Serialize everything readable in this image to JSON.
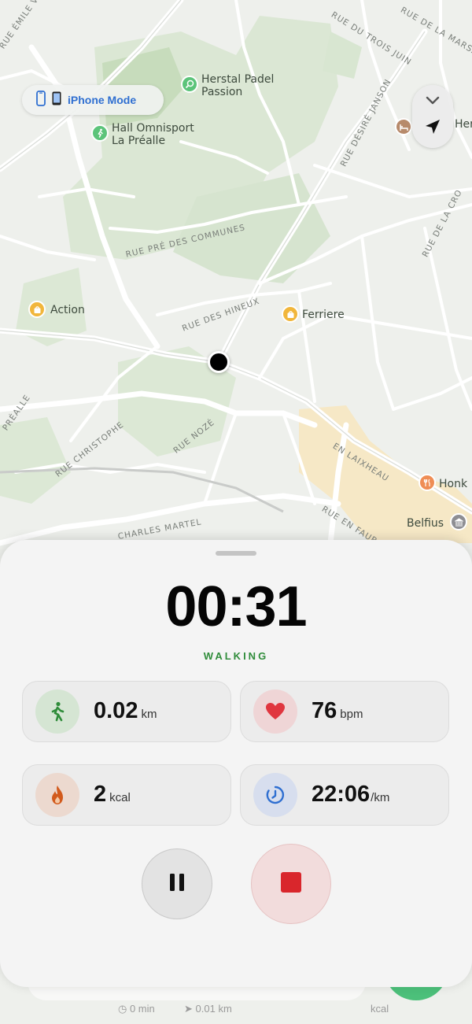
{
  "map": {
    "mode_pill": {
      "label": "iPhone Mode",
      "icon": "phone-icon"
    },
    "places": [
      {
        "name": "Herstal Padel\nPassion",
        "icon": "tennis-icon"
      },
      {
        "name": "Hall Omnisport\nLa Préalle",
        "icon": "sport-icon"
      },
      {
        "name": "Action",
        "icon": "shopping-bag-icon"
      },
      {
        "name": "Ferriere",
        "icon": "shopping-bag-icon"
      },
      {
        "name": "Honk",
        "icon": "restaurant-icon"
      },
      {
        "name": "Belfius",
        "icon": "bank-icon"
      },
      {
        "name": "Hera",
        "icon": "hotel-icon"
      }
    ],
    "streets": [
      "RUE ÉMILE VINC",
      "RUE DU TROIS JUIN",
      "RUE DE LA MARSALLE",
      "RUE DÉSIRÉ JANSON",
      "RUE DE LA CRO",
      "RUE PRÉ DES COMMUNES",
      "RUE DES HINEUX",
      "PRÉALLE",
      "RUE CHRISTOPHE",
      "RUE NOZÉ",
      "EN LAIXHEAU",
      "RUE EN FAUB",
      "CHARLES MARTEL"
    ]
  },
  "workout": {
    "timer": "00:31",
    "activity": "WALKING",
    "stats": [
      {
        "value": "0.02",
        "unit": "km",
        "icon": "walking-icon",
        "accent": "#2f8c3a"
      },
      {
        "value": "76",
        "unit": "bpm",
        "icon": "heart-icon",
        "accent": "#e0363f"
      },
      {
        "value": "2",
        "unit": "kcal",
        "icon": "flame-icon",
        "accent": "#d25a1c"
      },
      {
        "value": "22:06",
        "unit": "/km",
        "icon": "pace-timer-icon",
        "accent": "#2f6fd1"
      }
    ],
    "controls": {
      "pause": "pause-icon",
      "stop": "stop-icon"
    }
  },
  "background_sheet": {
    "duration": "0 min",
    "distance": "0.01 km",
    "calories_unit": "kcal"
  },
  "colors": {
    "accent_green": "#2f8c3a",
    "stop_red": "#d9262c",
    "mode_blue": "#2f6fd1"
  }
}
